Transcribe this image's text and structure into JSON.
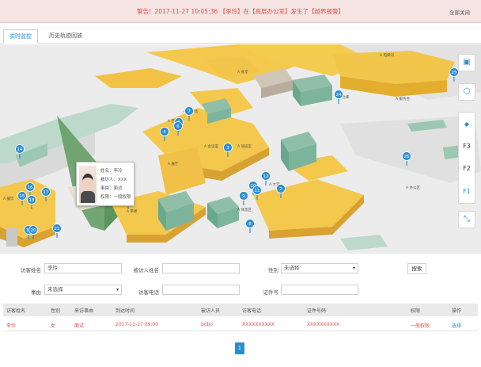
{
  "alert": {
    "text": "警告！2017-11-27 10:05:36 【李玲】在【高层办公室】发生了【越界报警】",
    "close_label": "全部关闭"
  },
  "tabs": [
    "实时监控",
    "历史轨迹回放"
  ],
  "map": {
    "zones": [
      {
        "label": "A 餐饮"
      },
      {
        "label": "A 茶楼"
      },
      {
        "label": "A 食堂"
      },
      {
        "label": "A 营业厅"
      },
      {
        "label": "A 展厅"
      },
      {
        "label": "A 会议室"
      },
      {
        "label": "A 大堂"
      },
      {
        "label": "A 仓库"
      },
      {
        "label": "A 休息区"
      },
      {
        "label": "A 电梯间"
      },
      {
        "label": "A 服务台"
      },
      {
        "label": "A 办公区"
      },
      {
        "label": "A 停车场"
      },
      {
        "label": "A 值班室"
      }
    ],
    "markers": [
      "14",
      "15",
      "16",
      "17",
      "18",
      "19",
      "20",
      "21",
      "22",
      "13",
      "4",
      "5",
      "6",
      "7",
      "3",
      "2",
      "9",
      "10",
      "11",
      "12",
      "8",
      "24",
      "25",
      "26",
      "23"
    ],
    "alarm_marker": "1",
    "floors": [
      "F3",
      "F2",
      "F1"
    ],
    "tool_icons": [
      "shop-icon",
      "hexagon-icon",
      "layers-icon",
      "fullscreen-icon"
    ]
  },
  "popup": {
    "name_line": "姓名：李玲",
    "host_line": "被访人：XXX",
    "reason_line": "事由：面试",
    "permission_line": "权限：一般权限"
  },
  "search_form": {
    "visitor_name_label": "访客姓名",
    "visitor_name_value": "李玲",
    "host_name_label": "被访人姓名",
    "host_name_value": "",
    "gender_label": "性别",
    "gender_value": "未选择",
    "search_button": "搜索",
    "reason_label": "事由",
    "reason_value": "未选择",
    "phone_label": "访客电话",
    "phone_value": "",
    "id_label": "证件号",
    "id_value": ""
  },
  "table": {
    "headers": [
      "访客姓名",
      "性别",
      "来访事由",
      "到达时间",
      "被访人员",
      "访客电话",
      "证件号码",
      "权限",
      "操作"
    ],
    "rows": [
      [
        "李玲",
        "女",
        "面试",
        "2017-11-27 09:00",
        "bobo",
        "XXXXXXXXXX",
        "XXXXXXXXXX",
        "一般权限",
        "选择"
      ]
    ]
  },
  "pagination": {
    "current": "1"
  }
}
